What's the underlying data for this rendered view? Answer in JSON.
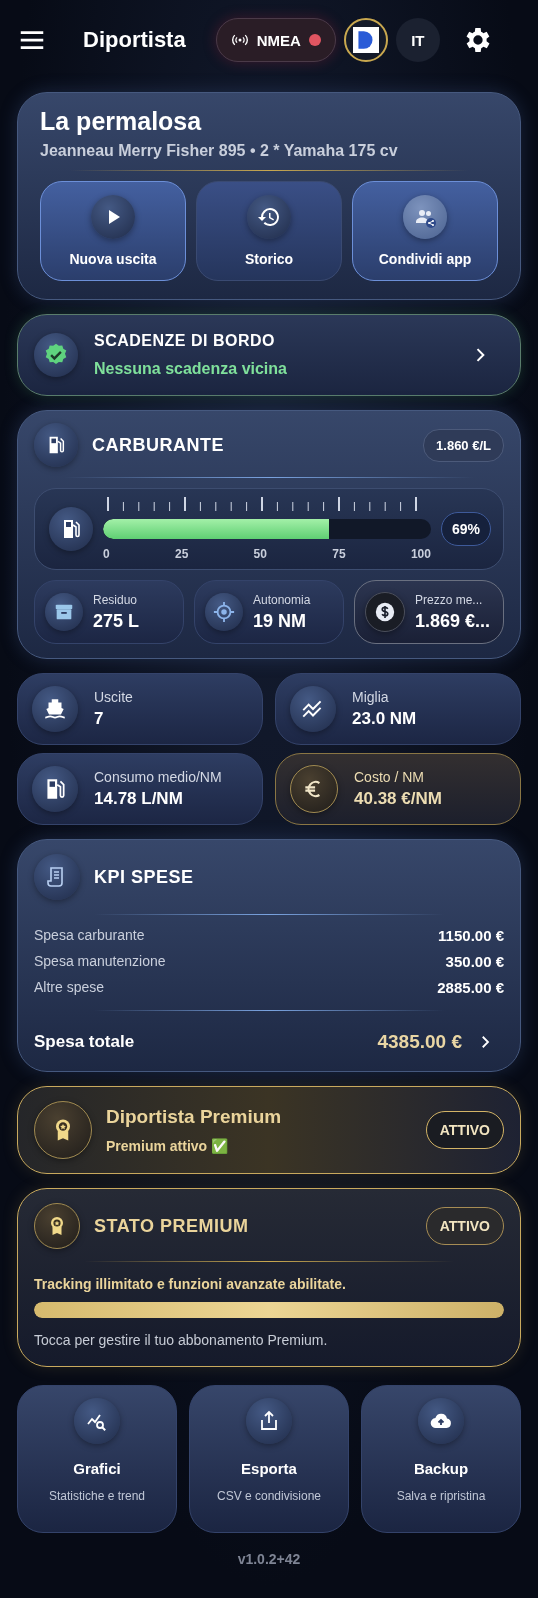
{
  "app_bar": {
    "title": "Diportista",
    "nmea": {
      "label": "NMEA",
      "connected": false
    },
    "language": "IT"
  },
  "boat": {
    "name": "La permalosa",
    "details": "Jeanneau Merry Fisher 895 • 2 * Yamaha 175 cv",
    "actions": [
      {
        "label": "Nuova uscita",
        "highlighted": true
      },
      {
        "label": "Storico",
        "highlighted": false
      },
      {
        "label": "Condividi app",
        "highlighted": true
      }
    ]
  },
  "deadlines": {
    "title": "SCADENZE DI BORDO",
    "status": "Nessuna scadenza vicina"
  },
  "fuel": {
    "title": "CARBURANTE",
    "price": "1.860 €/L",
    "level": 0.69,
    "percent": "69%",
    "scale": [
      "0",
      "25",
      "50",
      "75",
      "100"
    ],
    "tiles": [
      {
        "label": "Residuo",
        "value": "275 L",
        "highlighted": false
      },
      {
        "label": "Autonomia",
        "value": "19 NM",
        "highlighted": false
      },
      {
        "label": "Prezzo me...",
        "value": "1.869 €...",
        "highlighted": true
      }
    ]
  },
  "stats": [
    {
      "label": "Uscite",
      "value": "7",
      "highlighted": false
    },
    {
      "label": "Miglia",
      "value": "23.0 NM",
      "highlighted": false
    },
    {
      "label": "Consumo medio/NM",
      "value": "14.78 L/NM",
      "highlighted": false
    },
    {
      "label": "Costo / NM",
      "value": "40.38 €/NM",
      "highlighted": true
    }
  ],
  "expenses": {
    "title": "KPI SPESE",
    "rows": [
      {
        "label": "Spesa carburante",
        "value": "1150.00 €"
      },
      {
        "label": "Spesa manutenzione",
        "value": "350.00 €"
      },
      {
        "label": "Altre spese",
        "value": "2885.00 €"
      }
    ],
    "total_label": "Spesa totale",
    "total_value": "4385.00 €"
  },
  "premium": {
    "title": "Diportista Premium",
    "subtitle": "Premium attivo ✅",
    "badge": "ATTIVO"
  },
  "premium_status": {
    "title": "STATO PREMIUM",
    "badge": "ATTIVO",
    "description": "Tracking illimitato e funzioni avanzate abilitate.",
    "level": 1,
    "footer": "Tocca per gestire il tuo abbonamento Premium."
  },
  "tools": [
    {
      "title": "Grafici",
      "subtitle": "Statistiche e trend"
    },
    {
      "title": "Esporta",
      "subtitle": "CSV e condivisione"
    },
    {
      "title": "Backup",
      "subtitle": "Salva e ripristina"
    }
  ],
  "version": "v1.0.2+42"
}
